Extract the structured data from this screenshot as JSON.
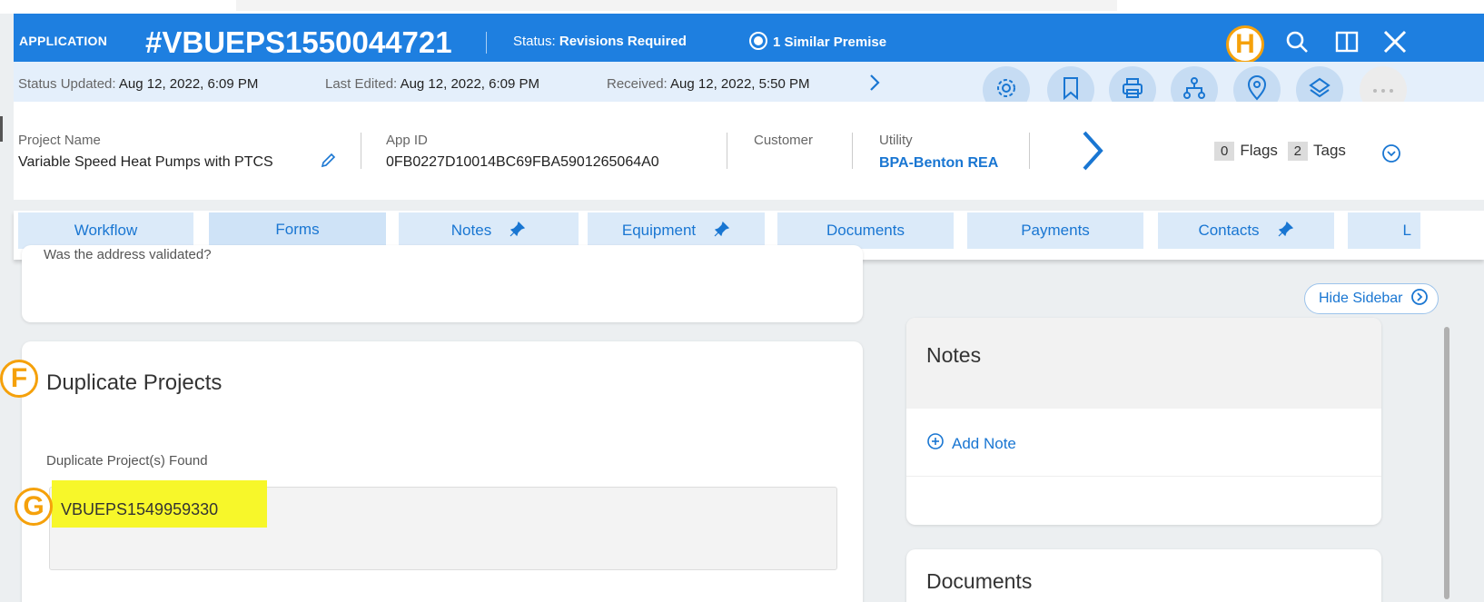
{
  "header": {
    "app_label": "APPLICATION",
    "app_number": "#VBUEPS1550044721",
    "status_key": "Status:",
    "status_value": "Revisions Required",
    "similar_premise": "1 Similar Premise",
    "marker_h": "H"
  },
  "subbar": {
    "status_updated_key": "Status Updated:",
    "status_updated_val": "Aug 12, 2022, 6:09 PM",
    "last_edited_key": "Last Edited:",
    "last_edited_val": "Aug 12, 2022, 6:09 PM",
    "received_key": "Received:",
    "received_val": "Aug 12, 2022, 5:50 PM"
  },
  "info": {
    "project_name_label": "Project Name",
    "project_name": "Variable Speed Heat Pumps with PTCS",
    "app_id_label": "App ID",
    "app_id": "0FB0227D10014BC69FBA5901265064A0",
    "customer_label": "Customer",
    "utility_label": "Utility",
    "utility_value": "BPA-Benton REA",
    "flags_count": "0",
    "flags_label": "Flags",
    "tags_count": "2",
    "tags_label": "Tags"
  },
  "tabs": [
    {
      "label": "Workflow"
    },
    {
      "label": "Forms"
    },
    {
      "label": "Notes"
    },
    {
      "label": "Equipment"
    },
    {
      "label": "Documents"
    },
    {
      "label": "Payments"
    },
    {
      "label": "Contacts"
    },
    {
      "label": "L"
    }
  ],
  "main": {
    "cut_text": "Was the address validated?",
    "marker_f": "F",
    "duplicate_title": "Duplicate Projects",
    "duplicate_label": "Duplicate Project(s) Found",
    "marker_g": "G",
    "duplicate_value": "VBUEPS1549959330"
  },
  "sidebar": {
    "hide_label": "Hide Sidebar",
    "notes_title": "Notes",
    "add_note": "Add Note",
    "next_title": "Documents"
  },
  "colors": {
    "header_blue": "#1e7fe0",
    "accent_orange": "#f5a10b",
    "highlight_yellow": "#f7f72a",
    "link_blue": "#1976d2"
  }
}
